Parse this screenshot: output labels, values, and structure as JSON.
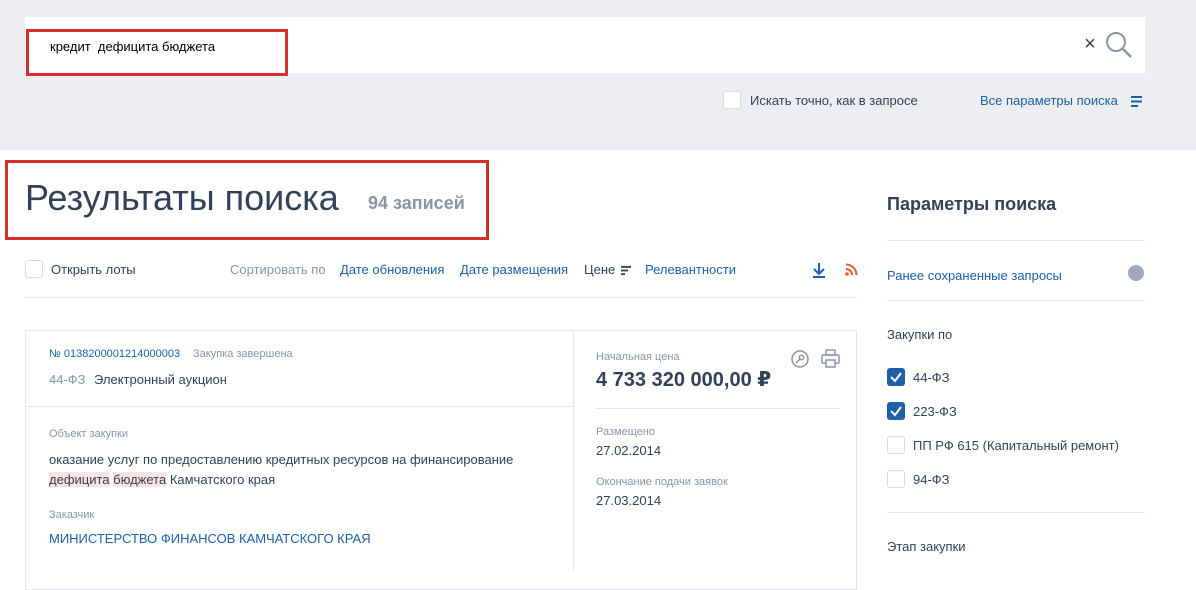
{
  "search": {
    "query": "кредит  дефицита бюджета",
    "clear_icon": "close-icon",
    "search_icon": "magnifier-icon",
    "exact_label": "Искать точно, как в запросе",
    "all_params": "Все параметры поиска"
  },
  "results": {
    "title": "Результаты поиска",
    "count": "94 записей",
    "open_lots": "Открыть лоты",
    "sort_label": "Сортировать по",
    "sort_options": [
      "Дате обновления",
      "Дате размещения",
      "Цене",
      "Релевантности"
    ]
  },
  "card": {
    "number": "№ 0138200001214000003",
    "status": "Закупка завершена",
    "law": "44-ФЗ",
    "method": "Электронный аукцион",
    "object_label": "Объект закупки",
    "object_text_1": "оказание услуг по предоставлению кредитных ресурсов на финансирование",
    "object_hl_1": "дефицита",
    "object_hl_2": "бюджета",
    "object_text_2": "Камчатского края",
    "customer_label": "Заказчик",
    "customer": "МИНИСТЕРСТВО ФИНАНСОВ КАМЧАТСКОГО КРАЯ",
    "price_label": "Начальная цена",
    "price": "4 733 320 000,00 ₽",
    "posted_label": "Размещено",
    "posted": "27.02.2014",
    "deadline_label": "Окончание подачи заявок",
    "deadline": "27.03.2014"
  },
  "sidebar": {
    "title": "Параметры поиска",
    "saved": "Ранее сохраненные запросы",
    "purchases_label": "Закупки по",
    "laws": [
      {
        "label": "44-ФЗ",
        "checked": true
      },
      {
        "label": "223-ФЗ",
        "checked": true
      },
      {
        "label": "ПП РФ 615 (Капитальный ремонт)",
        "checked": false
      },
      {
        "label": "94-ФЗ",
        "checked": false
      }
    ],
    "stage_label": "Этап закупки"
  },
  "colors": {
    "accent": "#1e5fa8",
    "highlight_box": "#d32f2f",
    "mark": "#fbe3e0"
  }
}
